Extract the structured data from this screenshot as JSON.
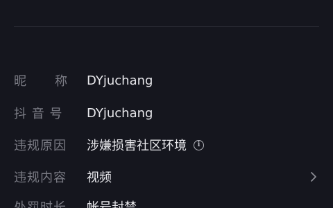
{
  "profile_info": {
    "nickname": {
      "label_chars": [
        "昵",
        "称"
      ],
      "value": "DYjuchang"
    },
    "douyin_id": {
      "label": "抖 音 号",
      "value": "DYjuchang"
    },
    "violation_reason": {
      "label": "违规原因",
      "value": "涉嫌损害社区环境",
      "icon": "info-icon"
    },
    "violation_content": {
      "label": "违规内容",
      "value": "视频",
      "icon": "chevron-right-icon"
    },
    "penalty_time": {
      "label": "处罚时长",
      "value": "帐号封禁"
    }
  },
  "colors": {
    "background": "#15161e",
    "label": "#7b7c85",
    "value": "#e8e8ec",
    "divider": "#2b2c35"
  }
}
